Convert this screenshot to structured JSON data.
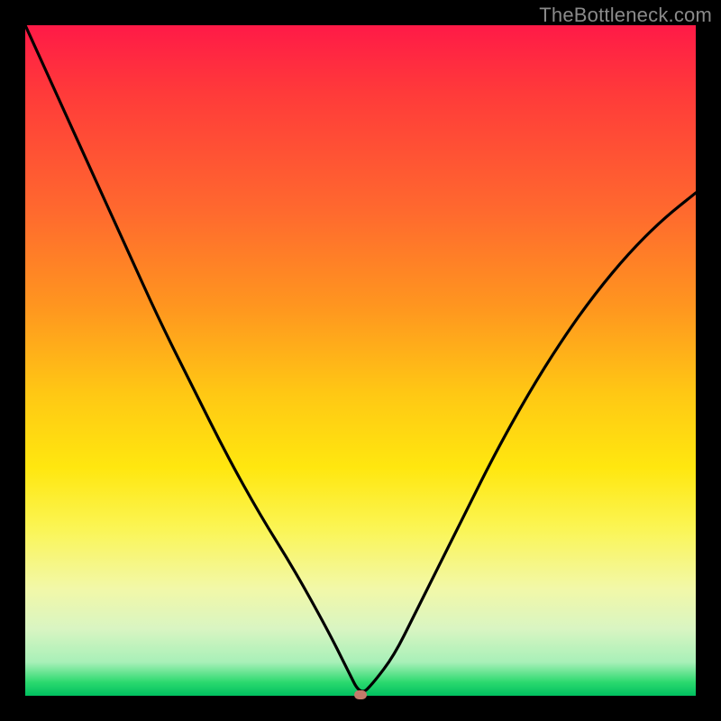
{
  "watermark": "TheBottleneck.com",
  "colors": {
    "curve_stroke": "#000000",
    "marker_fill": "#c47a6a"
  },
  "chart_data": {
    "type": "line",
    "title": "",
    "xlabel": "",
    "ylabel": "",
    "xlim": [
      0,
      100
    ],
    "ylim": [
      0,
      100
    ],
    "grid": false,
    "legend": false,
    "annotations": [],
    "curve": {
      "x": [
        0,
        5,
        10,
        15,
        20,
        25,
        30,
        35,
        40,
        45,
        48,
        50,
        52,
        55,
        58,
        62,
        66,
        70,
        75,
        80,
        85,
        90,
        95,
        100
      ],
      "y": [
        100,
        89,
        78,
        67,
        56,
        46,
        36,
        27,
        19,
        10,
        4,
        0,
        2,
        6,
        12,
        20,
        28,
        36,
        45,
        53,
        60,
        66,
        71,
        75
      ]
    },
    "optimum_marker": {
      "x": 50,
      "y": 0
    },
    "background_gradient": {
      "top_color": "#ff1a47",
      "mid_color": "#ffe70f",
      "bottom_color": "#00c060"
    }
  }
}
